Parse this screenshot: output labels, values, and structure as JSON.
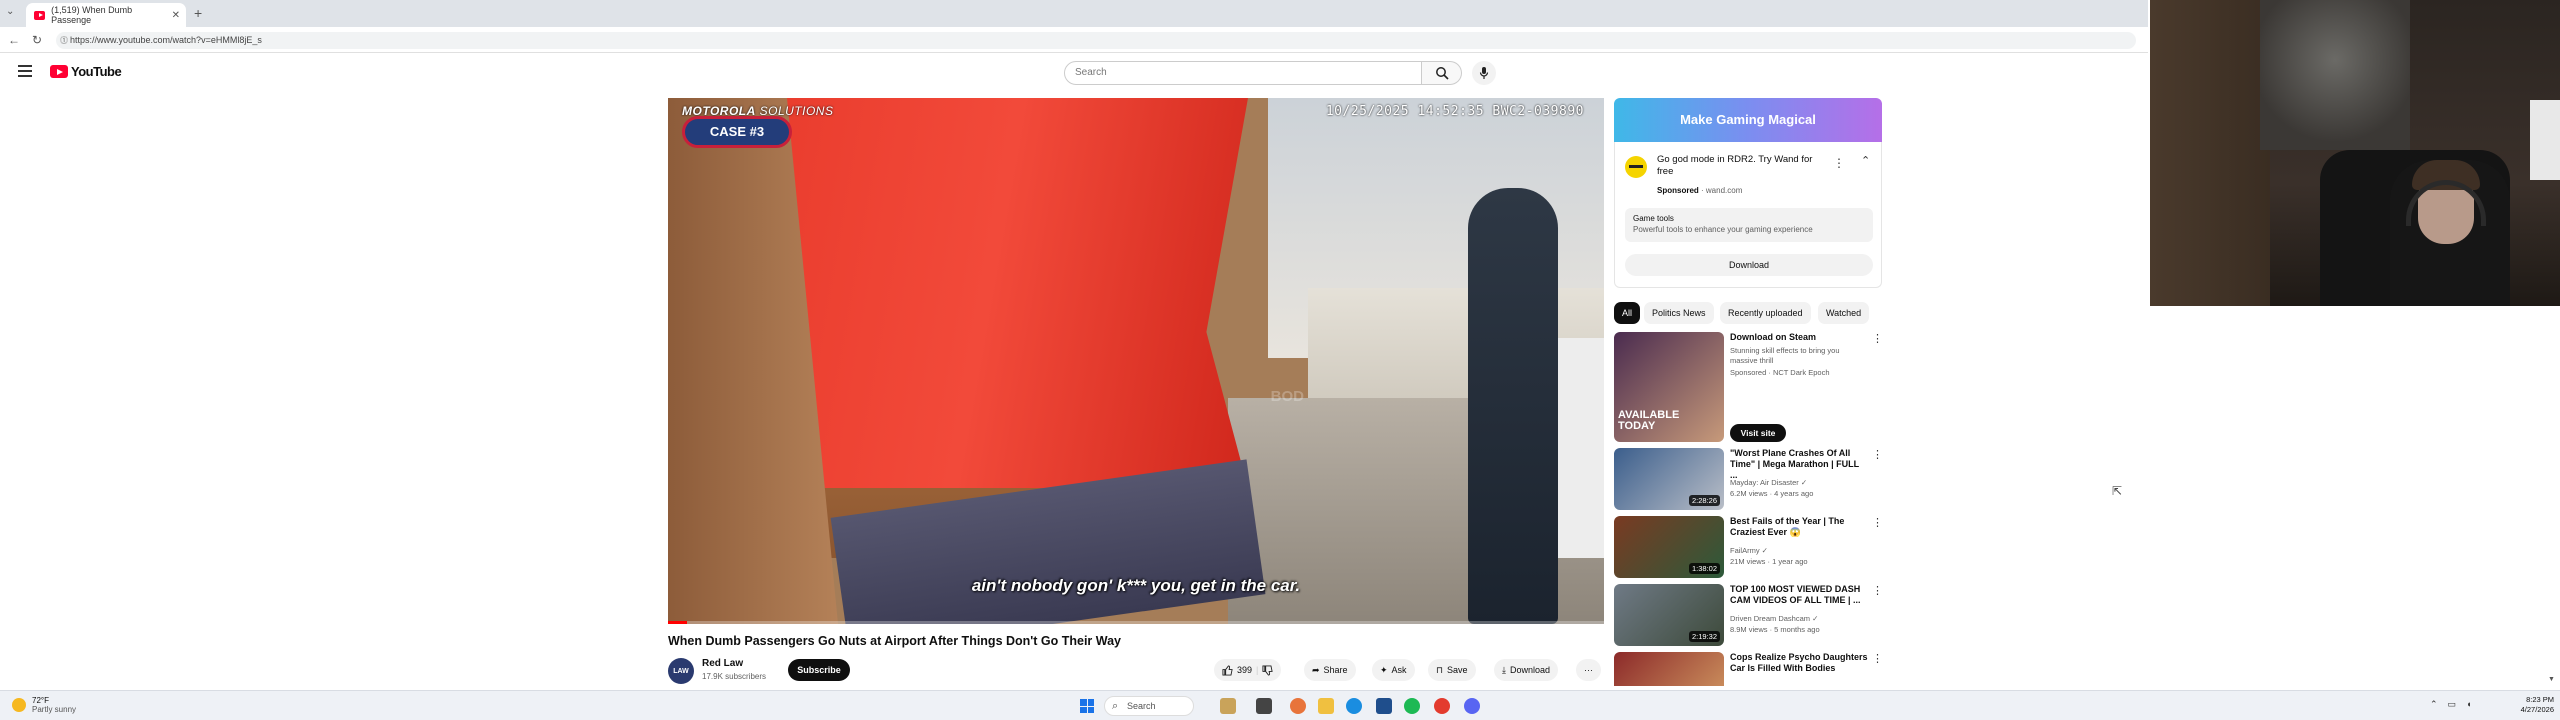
{
  "browser": {
    "tab_title": "(1,519) When Dumb Passenge",
    "tab_close": "✕",
    "new_tab": "+",
    "tab_list": "⌄",
    "url": "https://www.youtube.com/watch?v=eHMMl8jE_s",
    "back": "←",
    "reload": "↻"
  },
  "youtube": {
    "logo_text": "YouTube",
    "search_placeholder": "Search"
  },
  "player": {
    "bodycam_brand_bold": "MOTOROLA",
    "bodycam_brand_thin": " SOLUTIONS",
    "bodycam_stamp": "10/25/2025 14:52:35 BWC2-039890",
    "case_badge": "CASE #3",
    "caption": "ain't nobody gon' k*** you, get in the car.",
    "watermark": "BOD",
    "progress": 0.02
  },
  "video": {
    "title": "When Dumb Passengers Go Nuts at Airport After Things Don't Go Their Way",
    "channel_name": "Red Law",
    "channel_avatar": "LAW",
    "channel_subs": "17.9K subscribers",
    "subscribe_label": "Subscribe",
    "like_count": "399",
    "share_label": "Share",
    "ask_label": "Ask",
    "save_label": "Save",
    "download_label": "Download",
    "more_label": "···"
  },
  "ad": {
    "banner": "Make Gaming Magical",
    "headline": "Go god mode in RDR2. Try Wand for free",
    "sponsored": "Sponsored",
    "domain": " · wand.com",
    "sub_title": "Game tools",
    "sub_desc": "Powerful tools to enhance your gaming experience",
    "download": "Download",
    "more": "⋮",
    "collapse": "⌃"
  },
  "chips": [
    "All",
    "Politics News",
    "Recently uploaded",
    "Watched"
  ],
  "recommendations": [
    {
      "title": "Download on Steam",
      "meta1": "Stunning skill effects to bring you massive thrill",
      "meta2": "Sponsored · NCT Dark Epoch",
      "duration": "",
      "cta": "Visit site",
      "thumb_text": "AVAILABLE TODAY",
      "colors": [
        "#4a2b4f",
        "#c79a7a"
      ]
    },
    {
      "title": "\"Worst Plane Crashes Of All Time\" | Mega Marathon | FULL ...",
      "meta1": "Mayday: Air Disaster ✓",
      "meta2": "6.2M views · 4 years ago",
      "duration": "2:28:26",
      "colors": [
        "#3b5e8c",
        "#b9bec7"
      ]
    },
    {
      "title": "Best Fails of the Year | The Craziest Ever 😱",
      "meta1": "FailArmy ✓",
      "meta2": "21M views · 1 year ago",
      "duration": "1:38:02",
      "colors": [
        "#7a3a22",
        "#2c5a3a"
      ]
    },
    {
      "title": "TOP 100 MOST VIEWED DASH CAM VIDEOS OF ALL TIME | ...",
      "meta1": "Driven Dream Dashcam ✓",
      "meta2": "8.9M views · 5 months ago",
      "duration": "2:19:32",
      "colors": [
        "#6f7a86",
        "#3d4a3a"
      ]
    },
    {
      "title": "Cops Realize Psycho Daughters Car Is Filled With Bodies",
      "meta1": "",
      "meta2": "",
      "duration": "",
      "colors": [
        "#8c2a2a",
        "#c88a5a"
      ]
    }
  ],
  "taskbar": {
    "weather_temp": "72°F",
    "weather_desc": "Partly sunny",
    "search": "Search",
    "time": "8:23 PM",
    "date": "4/27/2026"
  }
}
